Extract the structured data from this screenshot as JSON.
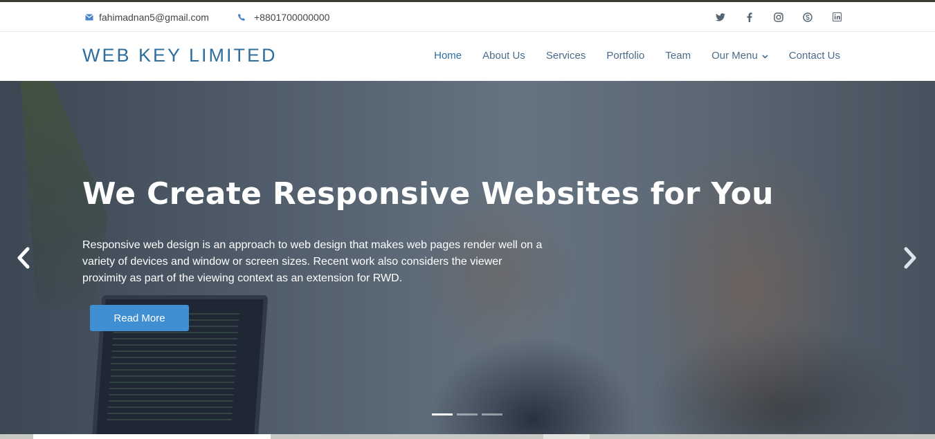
{
  "topbar": {
    "email": "fahimadnan5@gmail.com",
    "phone": "+8801700000000",
    "socials": [
      "twitter-icon",
      "facebook-icon",
      "instagram-icon",
      "skype-icon",
      "linkedin-icon"
    ]
  },
  "brand": {
    "name": "WEB KEY LIMITED",
    "color": "#2e6e9e"
  },
  "nav": {
    "items": [
      {
        "label": "Home"
      },
      {
        "label": "About Us"
      },
      {
        "label": "Services"
      },
      {
        "label": "Portfolio"
      },
      {
        "label": "Team"
      },
      {
        "label": "Our Menu"
      },
      {
        "label": "Contact Us"
      }
    ]
  },
  "hero": {
    "title": "We Create Responsive Websites for You",
    "text": "Responsive web design is an approach to web design that makes web pages render well on a variety of devices and window or screen sizes. Recent work also considers the viewer proximity as part of the viewing context as an extension for RWD.",
    "button_label": "Read More",
    "slides": 3,
    "active_slide": 1,
    "button_color": "#3f8fd2"
  }
}
